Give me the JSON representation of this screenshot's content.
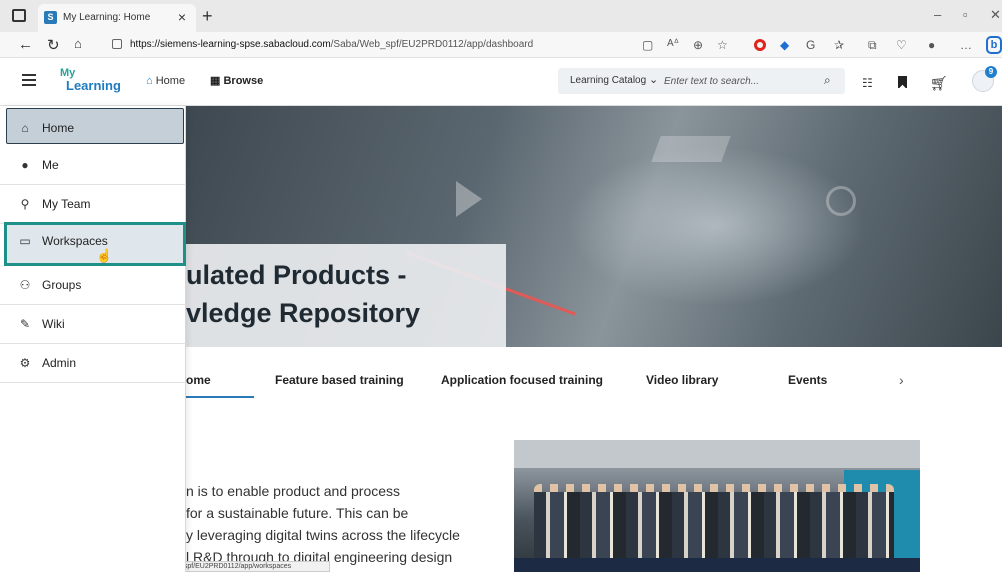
{
  "browser": {
    "tab_title": "My Learning: Home",
    "tab_favicon": "S",
    "url_host": "https://siemens-learning-spse.sabacloud.com",
    "url_path": "/Saba/Web_spf/EU2PRD0112/app/dashboard",
    "status_url": "https://siemens-learning-spse.sabacloud.com/Saba/Web_spf/EU2PRD0112/app/workspaces",
    "icons": [
      "sidebar-toggle-icon",
      "back-icon",
      "refresh-icon",
      "home-icon",
      "lock-icon",
      "reader-icon",
      "read-aloud-icon",
      "zoom-icon",
      "favorite-icon",
      "favorites-icon",
      "collections-icon",
      "bing-icon"
    ]
  },
  "header": {
    "logo_my": "My",
    "logo_learning": "Learning",
    "nav_home": "Home",
    "nav_browse": "Browse",
    "search_scope": "Learning Catalog",
    "search_placeholder": "Enter text to search...",
    "avatar_badge": "9",
    "accent": "#1e7cc0"
  },
  "sidebar": {
    "items": [
      {
        "label": "Home",
        "icon": "home-icon",
        "state": "selected"
      },
      {
        "label": "Me",
        "icon": "person-icon"
      },
      {
        "label": "My Team",
        "icon": "team-icon"
      },
      {
        "label": "Workspaces",
        "icon": "workspace-icon",
        "state": "hover-focus"
      },
      {
        "label": "Groups",
        "icon": "groups-icon"
      },
      {
        "label": "Wiki",
        "icon": "wiki-icon"
      },
      {
        "label": "Admin",
        "icon": "admin-icon"
      }
    ]
  },
  "hero": {
    "title": "ulated Products -\nvledge Repository"
  },
  "page_tabs": [
    {
      "label": "ome",
      "active": true
    },
    {
      "label": "Feature based training"
    },
    {
      "label": "Application focused training"
    },
    {
      "label": "Video library"
    },
    {
      "label": "Events"
    }
  ],
  "content": {
    "lines": [
      "n is to enable product and process",
      "for a sustainable future. This can be",
      "y leveraging digital twins across the lifecycle",
      "l R&D through to digital engineering design"
    ]
  }
}
